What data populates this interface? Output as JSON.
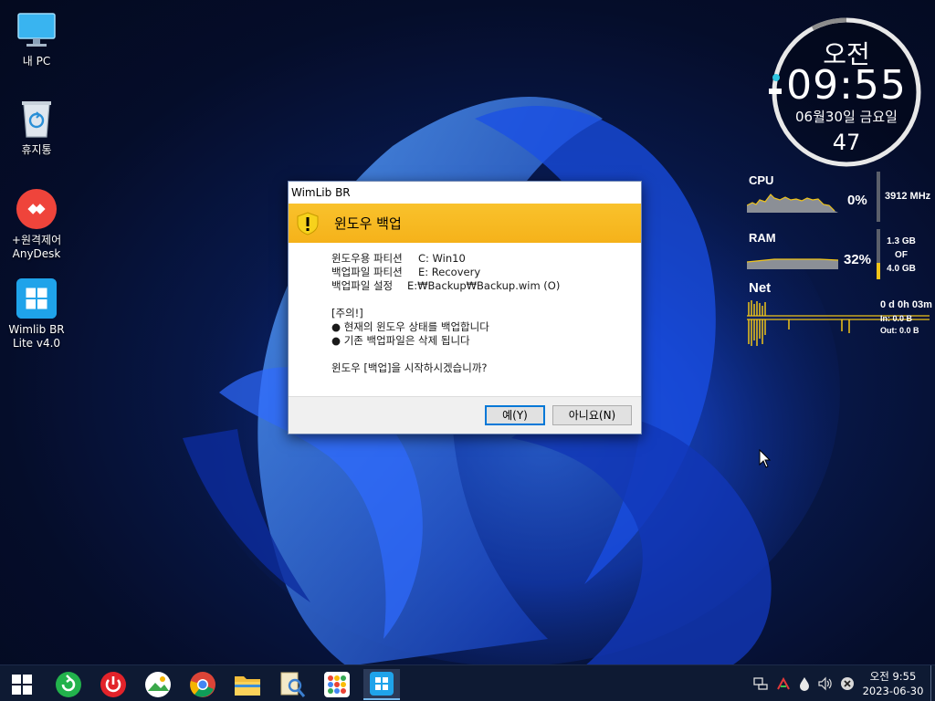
{
  "desktop": {
    "icons": [
      {
        "label": "내 PC",
        "icon": "monitor-icon"
      },
      {
        "label": "휴지통",
        "icon": "recycle-bin-icon"
      },
      {
        "label": "+원격제어\nAnyDesk",
        "line1": "+원격제어",
        "line2": "AnyDesk",
        "icon": "anydesk-icon"
      },
      {
        "label": "Wimlib BR Lite v4.0",
        "line1": "Wimlib BR",
        "line2": "Lite v4.0",
        "icon": "windows-logo-icon"
      }
    ]
  },
  "clock_widget": {
    "ampm": "오전",
    "time": "09:55",
    "date": "06월30일 금요일",
    "seconds": "47"
  },
  "monitor": {
    "cpu": {
      "label": "CPU",
      "percent": "0%",
      "freq": "3912 MHz",
      "level": 0.0
    },
    "ram": {
      "label": "RAM",
      "percent": "32%",
      "used": "1.3 GB",
      "of": "OF",
      "total": "4.0 GB",
      "level": 0.32
    },
    "net": {
      "label": "Net",
      "uptime": "0 d 0h 03m",
      "in": "In: 0.0 B",
      "out": "Out: 0.0 B"
    }
  },
  "dialog": {
    "window_title": "WimLib BR",
    "heading": "윈도우 백업",
    "rows": [
      {
        "key": "윈도우용 파티션",
        "value": "C:  Win10"
      },
      {
        "key": "백업파일 파티션",
        "value": "E:  Recovery"
      },
      {
        "key": "백업파일 설정",
        "value": "E:₩Backup₩Backup.wim (O)"
      }
    ],
    "notice_title": "[주의!]",
    "notices": [
      "● 현재의 윈도우 상태를 백업합니다",
      "● 기존 백업파일은 삭제 됩니다"
    ],
    "question": "윈도우 [백업]을  시작하시겠습니까?",
    "yes_label": "예(Y)",
    "no_label": "아니요(N)"
  },
  "taskbar": {
    "apps": [
      "start-windows-icon",
      "refresh-icon",
      "power-icon",
      "photos-icon",
      "chrome-icon",
      "file-explorer-icon",
      "search-document-icon",
      "app-grid-icon",
      "wimlib-br-icon"
    ],
    "tray_icons": [
      "network-icon",
      "tools-icon",
      "drop-icon",
      "volume-icon",
      "close-circle-icon"
    ],
    "clock_time": "오전 9:55",
    "clock_date": "2023-06-30"
  },
  "colors": {
    "accent_yellow": "#f5b21a",
    "highlight_blue": "#0078d7",
    "taskbar": "#0e1a33"
  }
}
